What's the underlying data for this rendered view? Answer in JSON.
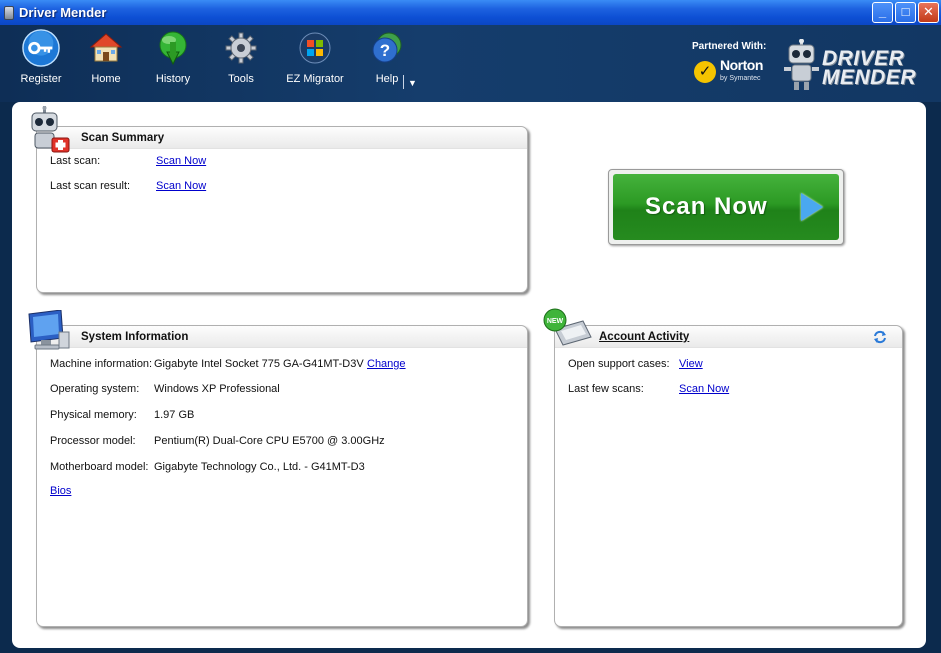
{
  "window": {
    "title": "Driver Mender"
  },
  "toolbar": {
    "items": [
      {
        "label": "Register",
        "icon": "key-icon"
      },
      {
        "label": "Home",
        "icon": "house-icon"
      },
      {
        "label": "History",
        "icon": "globe-arrow-icon"
      },
      {
        "label": "Tools",
        "icon": "gear-icon"
      },
      {
        "label": "EZ Migrator",
        "icon": "windows-logo-icon"
      },
      {
        "label": "Help",
        "icon": "help-globe-icon"
      }
    ],
    "partner_label": "Partnered With:",
    "norton_word": "Norton",
    "norton_sub": "by Symantec",
    "brand_line1": "DRIVER",
    "brand_line2": "MENDER"
  },
  "scan_summary": {
    "title": "Scan Summary",
    "rows": [
      {
        "label": "Last scan:",
        "link": "Scan Now"
      },
      {
        "label": "Last scan result:",
        "link": "Scan Now"
      }
    ]
  },
  "scan_button": {
    "label": "Scan Now"
  },
  "system_info": {
    "title": "System Information",
    "rows": [
      {
        "label": "Machine information:",
        "value": "Gigabyte Intel Socket 775 GA-G41MT-D3V",
        "link": "Change"
      },
      {
        "label": "Operating system:",
        "value": "Windows XP Professional"
      },
      {
        "label": "Physical memory:",
        "value": "1.97 GB"
      },
      {
        "label": "Processor model:",
        "value": "Pentium(R) Dual-Core CPU E5700 @ 3.00GHz"
      },
      {
        "label": "Motherboard model:",
        "value": "Gigabyte Technology Co., Ltd. - G41MT-D3"
      }
    ],
    "bios_link": "Bios"
  },
  "account": {
    "title": "Account Activity",
    "badge": "NEW",
    "rows": [
      {
        "label": "Open support cases:",
        "link": "View"
      },
      {
        "label": "Last few scans:",
        "link": "Scan Now"
      }
    ]
  },
  "colors": {
    "titlebar": "#0d4fd4",
    "toolbar": "#153d6c",
    "scan_green": "#2c9a24",
    "link": "#0000cc"
  }
}
